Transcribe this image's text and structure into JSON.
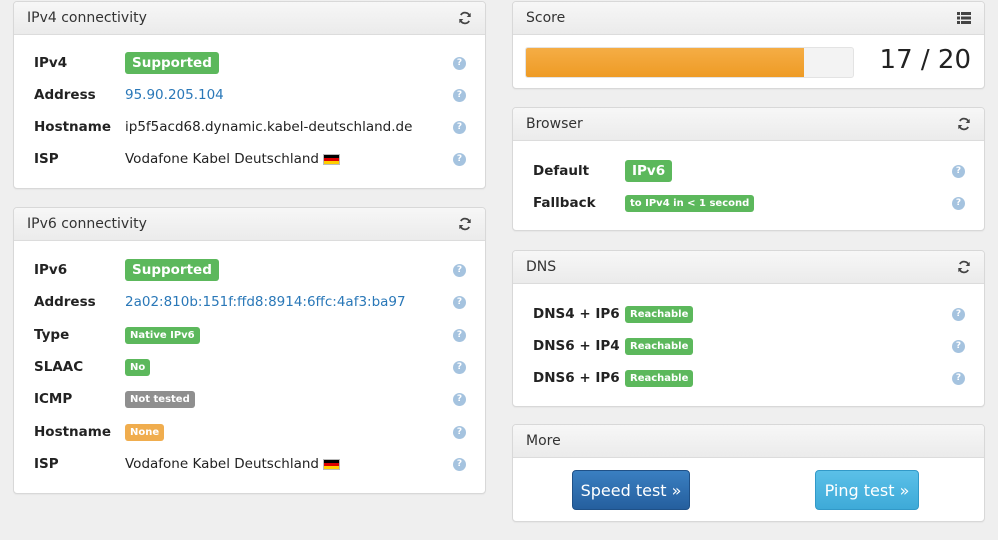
{
  "ipv4": {
    "title": "IPv4 connectivity",
    "rows": [
      {
        "label": "IPv4",
        "value": "Supported"
      },
      {
        "label": "Address",
        "value": "95.90.205.104"
      },
      {
        "label": "Hostname",
        "value": "ip5f5acd68.dynamic.kabel-deutschland.de"
      },
      {
        "label": "ISP",
        "value": "Vodafone Kabel Deutschland"
      }
    ]
  },
  "ipv6": {
    "title": "IPv6 connectivity",
    "rows": [
      {
        "label": "IPv6",
        "value": "Supported"
      },
      {
        "label": "Address",
        "value": "2a02:810b:151f:ffd8:8914:6ffc:4af3:ba97"
      },
      {
        "label": "Type",
        "value": "Native IPv6"
      },
      {
        "label": "SLAAC",
        "value": "No"
      },
      {
        "label": "ICMP",
        "value": "Not tested"
      },
      {
        "label": "Hostname",
        "value": "None"
      },
      {
        "label": "ISP",
        "value": "Vodafone Kabel Deutschland"
      }
    ]
  },
  "score": {
    "title": "Score",
    "text": "17 / 20",
    "fraction": 0.85
  },
  "browser": {
    "title": "Browser",
    "rows": [
      {
        "label": "Default",
        "value": "IPv6"
      },
      {
        "label": "Fallback",
        "value": "to IPv4 in < 1 second"
      }
    ]
  },
  "dns": {
    "title": "DNS",
    "rows": [
      {
        "label": "DNS4 + IP6",
        "value": "Reachable"
      },
      {
        "label": "DNS6 + IP4",
        "value": "Reachable"
      },
      {
        "label": "DNS6 + IP6",
        "value": "Reachable"
      }
    ]
  },
  "more": {
    "title": "More",
    "speed_test": "Speed test »",
    "ping_test": "Ping test »"
  },
  "icons": {
    "refresh": "refresh-icon",
    "list": "list-icon",
    "help": "question-circle-icon",
    "flag": "germany-flag-icon"
  },
  "colors": {
    "success": "#5cb85c",
    "default": "#8f8f8f",
    "warning": "#f0ad4e",
    "link": "#2a78b8",
    "progress": "#f0a02c",
    "btn_primary": "#2f70b4",
    "btn_info": "#4cb7e2"
  }
}
